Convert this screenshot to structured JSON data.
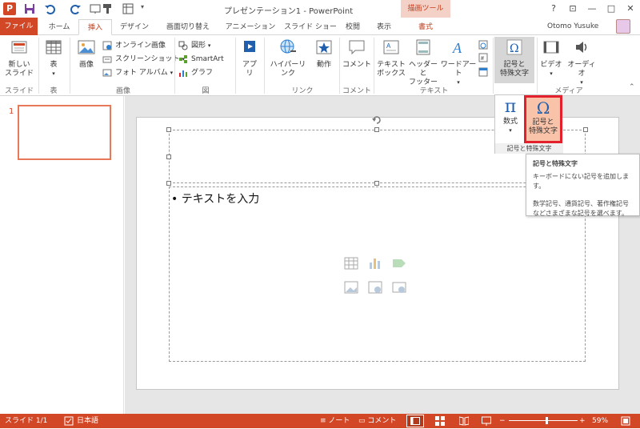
{
  "titlebar": {
    "title": "プレゼンテーション1 - PowerPoint",
    "tools_tab": "描画ツール",
    "logo": "P",
    "help": "?",
    "ribbon_opts": "⊡",
    "minimize": "—",
    "restore": "□",
    "close": "✕"
  },
  "tabs": {
    "file": "ファイル",
    "home": "ホーム",
    "insert": "挿入",
    "design": "デザイン",
    "transitions": "画面切り替え",
    "animations": "アニメーション",
    "slideshow": "スライド ショー",
    "review": "校閲",
    "view": "表示",
    "format": "書式",
    "user": "Otomo Yusuke"
  },
  "ribbon": {
    "new_slide": "新しい\nスライド",
    "table": "表",
    "image": "画像",
    "online_image": "オンライン画像",
    "screenshot": "スクリーンショット",
    "photo_album": "フォト アルバム",
    "shapes": "図形",
    "smartart": "SmartArt",
    "graph": "グラフ",
    "apps": "アプ\nリ",
    "hyperlink": "ハイパーリンク",
    "action": "動作",
    "comment": "コメント",
    "textbox": "テキスト\nボックス",
    "header_footer": "ヘッダーと\nフッター",
    "wordart": "ワードアート",
    "symbols": "記号と\n特殊文字",
    "video": "ビデオ",
    "audio": "オーディオ",
    "groups": {
      "slide": "スライド",
      "table": "表",
      "image": "画像",
      "figure": "図",
      "apps": "",
      "link": "リンク",
      "comment": "コメント",
      "text": "テキスト",
      "media": "メディア"
    }
  },
  "dropdown": {
    "math": "数式",
    "symbol": "記号と\n特殊文字",
    "group_label": "記号と特殊文字"
  },
  "tooltip": {
    "title": "記号と特殊文字",
    "line1": "キーボードにない記号を追加します。",
    "line2": "数学記号、通貨記号、著作権記号",
    "line3": "などさまざまな記号を選べます。"
  },
  "slide": {
    "number": "1",
    "bullet": "• テキストを入力"
  },
  "status": {
    "slide": "スライド 1/1",
    "language": "日本語",
    "notes": "ノート",
    "comments": "コメント",
    "zoom": "59%"
  },
  "colors": {
    "accent": "#d24726",
    "highlight": "#e2212c"
  }
}
